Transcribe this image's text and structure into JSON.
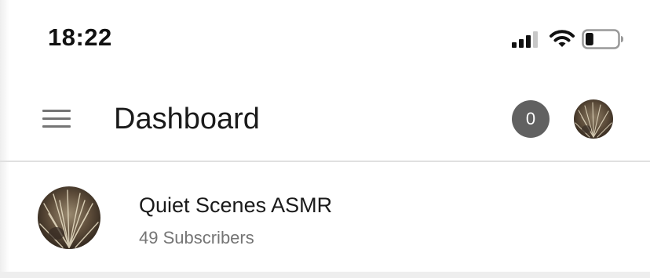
{
  "status_bar": {
    "time": "18:22",
    "icons": [
      "signal-icon",
      "wifi-icon",
      "battery-icon"
    ],
    "battery_level": 0.25
  },
  "app_bar": {
    "menu_icon": "hamburger-menu-icon",
    "title": "Dashboard",
    "notification_count": "0",
    "badge_color": "#616161"
  },
  "channel": {
    "name": "Quiet Scenes ASMR",
    "subscribers": "49 Subscribers"
  },
  "colors": {
    "primary_text": "#1a1a1a",
    "secondary_text": "#757575",
    "divider": "#e0e0e0"
  }
}
